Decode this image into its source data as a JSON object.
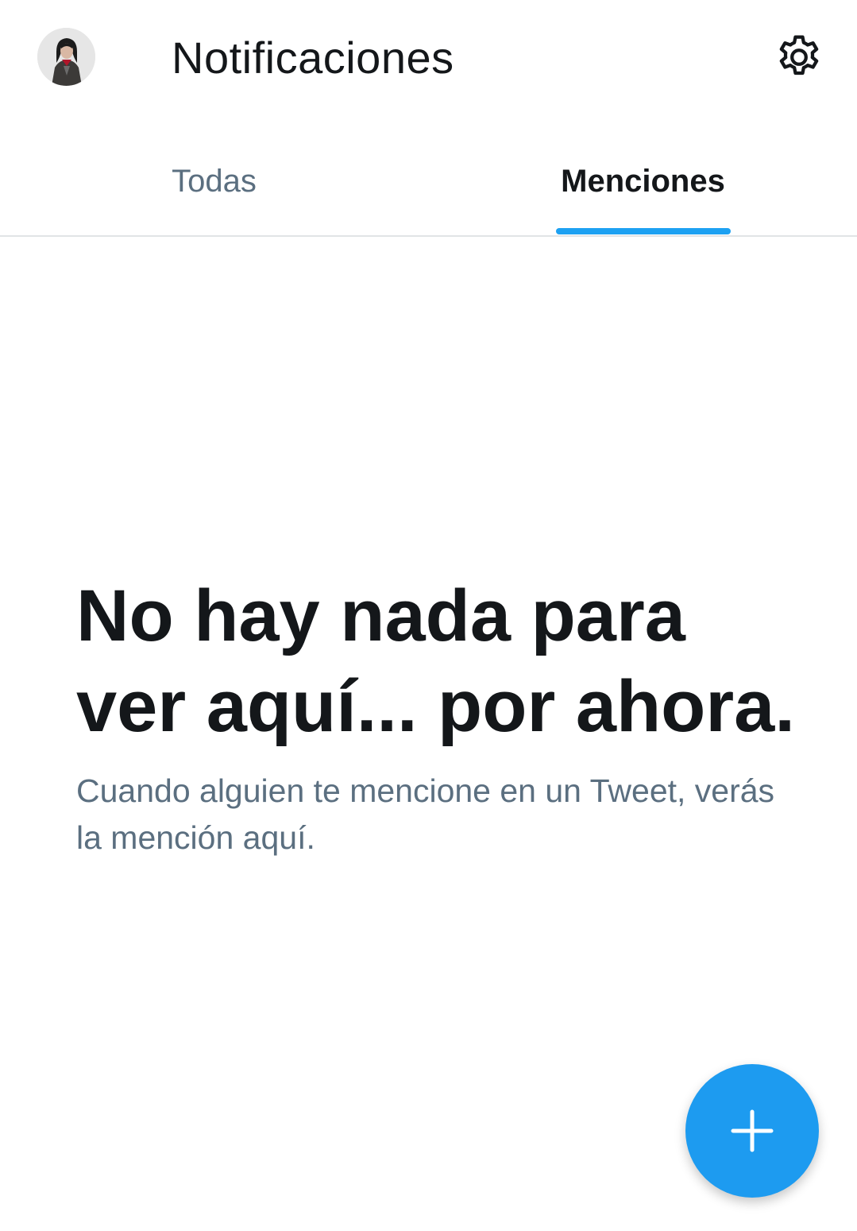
{
  "header": {
    "title": "Notificaciones",
    "avatar_icon": "profile-avatar",
    "settings_icon": "gear-icon"
  },
  "tabs": [
    {
      "label": "Todas",
      "active": false
    },
    {
      "label": "Menciones",
      "active": true
    }
  ],
  "empty_state": {
    "title": "No hay nada para ver aquí... por ahora.",
    "subtitle": "Cuando alguien te mencione en un Tweet, verás la mención aquí."
  },
  "fab": {
    "icon": "plus-icon"
  },
  "colors": {
    "accent": "#1da1f2",
    "text_primary": "#14171a",
    "text_secondary": "#5b6f80",
    "divider": "#e1e4e6"
  }
}
